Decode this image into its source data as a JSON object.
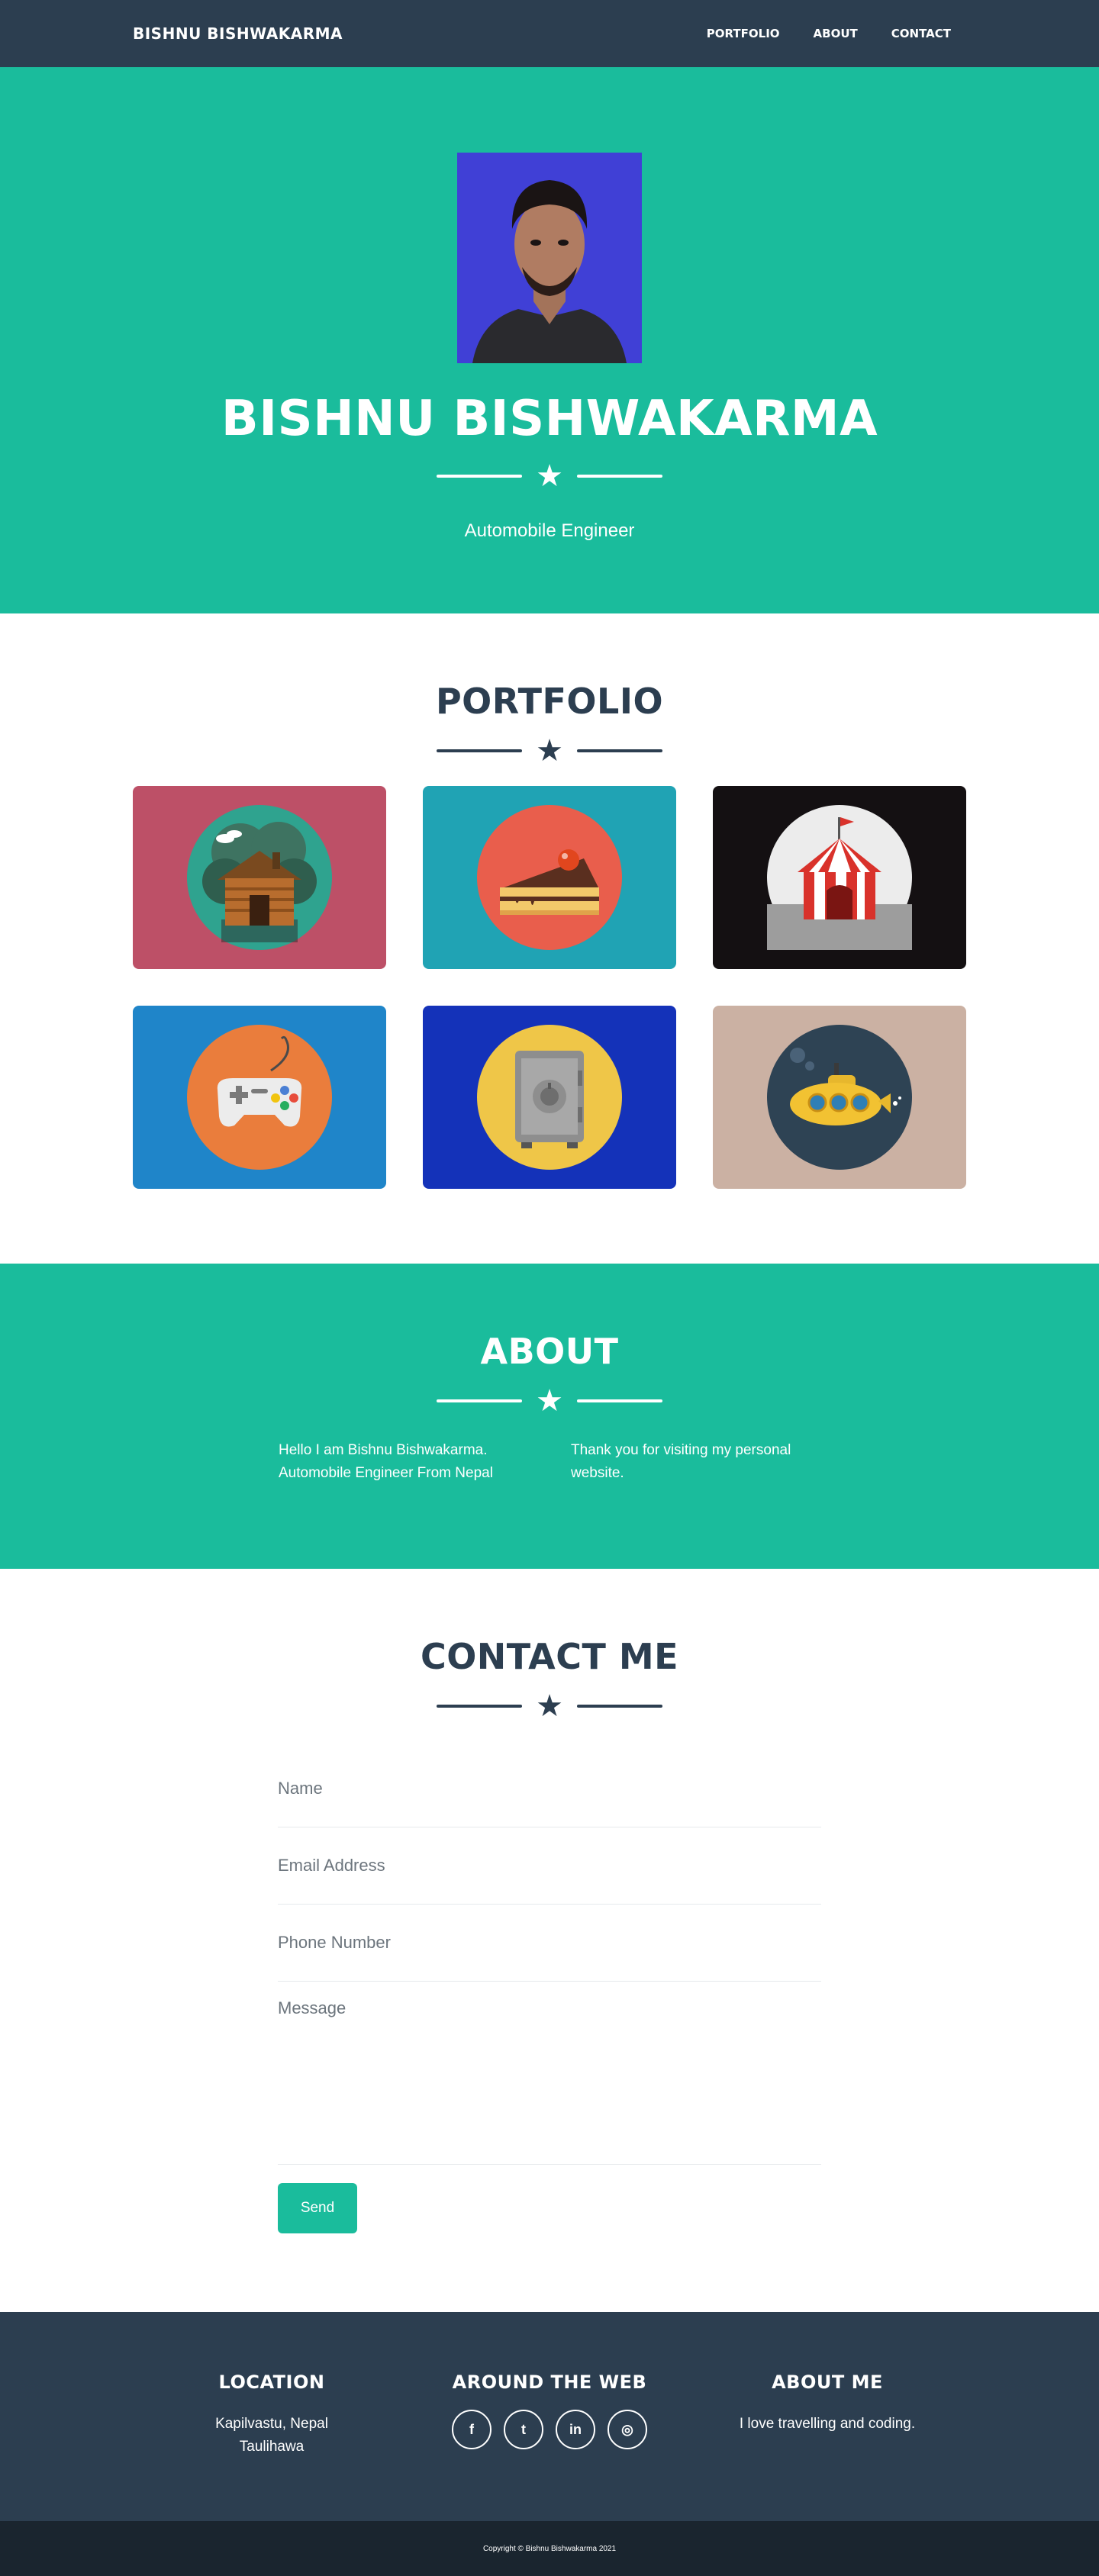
{
  "navbar": {
    "brand": "BISHNU BISHWAKARMA",
    "links": [
      "PORTFOLIO",
      "ABOUT",
      "CONTACT"
    ]
  },
  "masthead": {
    "title": "BISHNU BISHWAKARMA",
    "subtitle": "Automobile Engineer"
  },
  "portfolio": {
    "heading": "PORTFOLIO",
    "items": [
      {
        "icon": "cabin-icon",
        "bg": "#bd5067"
      },
      {
        "icon": "cake-icon",
        "bg": "#20a3b4"
      },
      {
        "icon": "circus-tent-icon",
        "bg": "#141012"
      },
      {
        "icon": "game-controller-icon",
        "bg": "#1f85c9"
      },
      {
        "icon": "safe-icon",
        "bg": "#1432b9"
      },
      {
        "icon": "submarine-icon",
        "bg": "#cbb1a3"
      }
    ]
  },
  "about": {
    "heading": "ABOUT",
    "left": "Hello I am Bishnu Bishwakarma. Automobile Engineer From Nepal",
    "right": "Thank you for visiting my personal website."
  },
  "contact": {
    "heading": "CONTACT ME",
    "name_placeholder": "Name",
    "email_placeholder": "Email Address",
    "phone_placeholder": "Phone Number",
    "message_placeholder": "Message",
    "send_label": "Send"
  },
  "footer": {
    "location_heading": "LOCATION",
    "location_line1": "Kapilvastu, Nepal",
    "location_line2": "Taulihawa",
    "web_heading": "AROUND THE WEB",
    "socials": [
      {
        "icon": "facebook-icon",
        "glyph": "f"
      },
      {
        "icon": "twitter-icon",
        "glyph": "t"
      },
      {
        "icon": "linkedin-icon",
        "glyph": "in"
      },
      {
        "icon": "dribbble-icon",
        "glyph": "◎"
      }
    ],
    "about_heading": "ABOUT ME",
    "about_text": "I love travelling and coding.",
    "copyright": "Copyright © Bishnu Bishwakarma 2021"
  },
  "colors": {
    "primary": "#1abc9c",
    "dark": "#2c3e50",
    "darker": "#1a252f"
  }
}
